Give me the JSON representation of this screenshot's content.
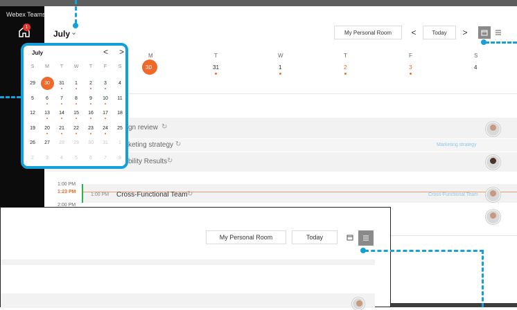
{
  "app": {
    "title": "Webex Teams",
    "badge": "1"
  },
  "header": {
    "month": "July",
    "personal_room": "My Personal Room",
    "today": "Today",
    "prev": "<",
    "next": ">"
  },
  "week": {
    "days": [
      {
        "label": "M",
        "num": "30",
        "selected": true,
        "dot": false
      },
      {
        "label": "T",
        "num": "31",
        "selected": false,
        "dot": true
      },
      {
        "label": "W",
        "num": "1",
        "selected": false,
        "dot": true
      },
      {
        "label": "T",
        "num": "2",
        "selected": false,
        "dot": true
      },
      {
        "label": "F",
        "num": "3",
        "selected": false,
        "dot": true
      },
      {
        "label": "S",
        "num": "4",
        "selected": false,
        "dot": false
      }
    ]
  },
  "events": [
    {
      "title": "gn review",
      "tag": "",
      "avatar": true,
      "dark": false
    },
    {
      "title": "keting strategy",
      "tag": "Marketing strategy",
      "avatar": false,
      "dark": false
    },
    {
      "title": "bility Results",
      "tag": "",
      "avatar": true,
      "dark": true
    }
  ],
  "timeline": {
    "label_1": "1:00 PM",
    "now": "1:23 PM",
    "label_2": "2:00 PM",
    "event_time": "1:00 PM",
    "event_title": "Cross-Functional Team",
    "event_tag": "Cross-Functional Team"
  },
  "minical": {
    "month": "July",
    "prev": "<",
    "next": ">",
    "weekdays": [
      "S",
      "M",
      "T",
      "W",
      "T",
      "F",
      "S"
    ],
    "weeks": [
      [
        {
          "d": "29",
          "f": false,
          "dot": false
        },
        {
          "d": "30",
          "f": false,
          "dot": false,
          "sel": true
        },
        {
          "d": "31",
          "f": false,
          "dot": true
        },
        {
          "d": "1",
          "f": false,
          "dot": true
        },
        {
          "d": "2",
          "f": false,
          "dot": true
        },
        {
          "d": "3",
          "f": false,
          "dot": true
        },
        {
          "d": "4",
          "f": false,
          "dot": false
        }
      ],
      [
        {
          "d": "5",
          "f": false,
          "dot": false
        },
        {
          "d": "6",
          "f": false,
          "dot": true
        },
        {
          "d": "7",
          "f": false,
          "dot": true
        },
        {
          "d": "8",
          "f": false,
          "dot": true
        },
        {
          "d": "9",
          "f": false,
          "dot": true
        },
        {
          "d": "10",
          "f": false,
          "dot": true
        },
        {
          "d": "11",
          "f": false,
          "dot": false
        }
      ],
      [
        {
          "d": "12",
          "f": false,
          "dot": false
        },
        {
          "d": "13",
          "f": false,
          "dot": true
        },
        {
          "d": "14",
          "f": false,
          "dot": true
        },
        {
          "d": "15",
          "f": false,
          "dot": true
        },
        {
          "d": "16",
          "f": false,
          "dot": true
        },
        {
          "d": "17",
          "f": false,
          "dot": true
        },
        {
          "d": "18",
          "f": false,
          "dot": false
        }
      ],
      [
        {
          "d": "19",
          "f": false,
          "dot": false
        },
        {
          "d": "20",
          "f": false,
          "dot": true
        },
        {
          "d": "21",
          "f": false,
          "dot": true
        },
        {
          "d": "22",
          "f": false,
          "dot": true
        },
        {
          "d": "23",
          "f": false,
          "dot": true
        },
        {
          "d": "24",
          "f": false,
          "dot": true
        },
        {
          "d": "25",
          "f": false,
          "dot": false
        }
      ],
      [
        {
          "d": "26",
          "f": false,
          "dot": false
        },
        {
          "d": "27",
          "f": false,
          "dot": false
        },
        {
          "d": "28",
          "f": true,
          "dot": false
        },
        {
          "d": "29",
          "f": true,
          "dot": false
        },
        {
          "d": "30",
          "f": true,
          "dot": false
        },
        {
          "d": "31",
          "f": true,
          "dot": false
        },
        {
          "d": "1",
          "f": true,
          "dot": false
        }
      ],
      [
        {
          "d": "2",
          "f": true,
          "dot": false
        },
        {
          "d": "3",
          "f": true,
          "dot": false
        },
        {
          "d": "4",
          "f": true,
          "dot": false
        },
        {
          "d": "5",
          "f": true,
          "dot": false
        },
        {
          "d": "6",
          "f": true,
          "dot": false
        },
        {
          "d": "7",
          "f": true,
          "dot": false
        },
        {
          "d": "8",
          "f": true,
          "dot": false
        }
      ]
    ]
  },
  "overlay": {
    "personal_room": "My Personal Room",
    "today": "Today"
  },
  "colors": {
    "accent": "#ef6a2a",
    "callout": "#14a0d9",
    "now_line": "#2db24a"
  }
}
